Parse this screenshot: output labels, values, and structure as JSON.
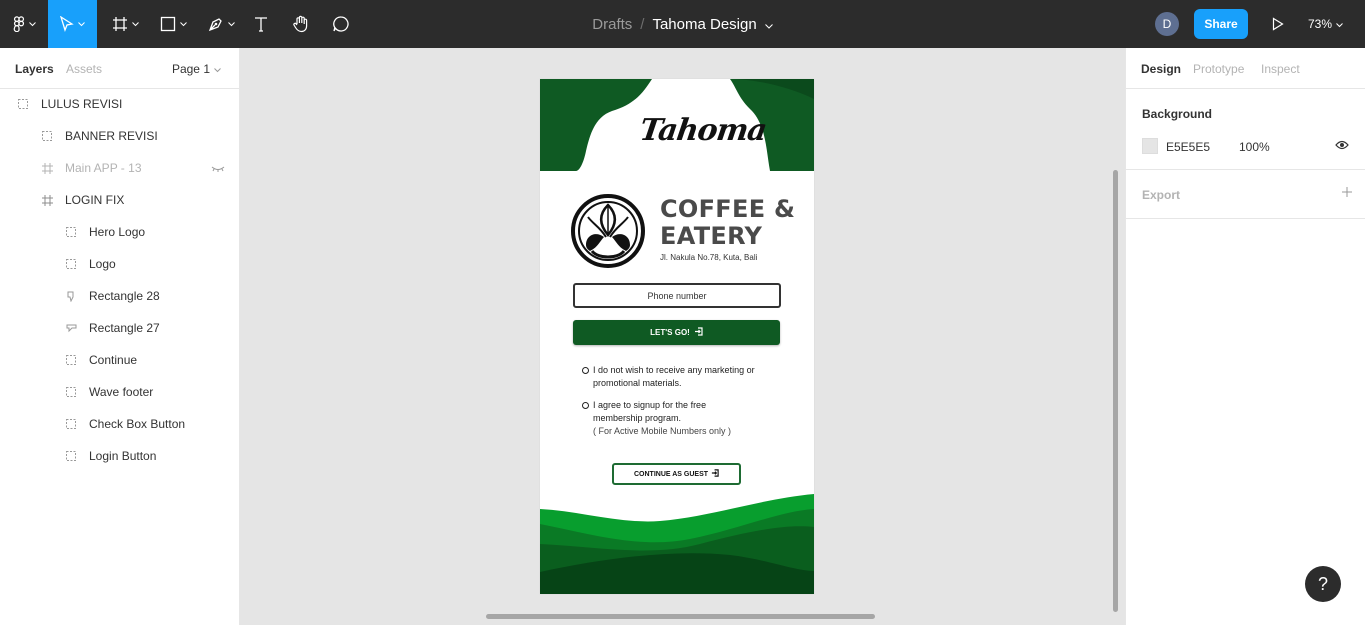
{
  "toolbar": {
    "breadcrumb": "Drafts",
    "separator": "/",
    "title": "Tahoma Design",
    "avatar_initial": "D",
    "share_label": "Share",
    "zoom": "73%",
    "accent": "#18a0fb"
  },
  "layers_panel": {
    "tab_layers": "Layers",
    "tab_assets": "Assets",
    "page": "Page 1",
    "items": [
      {
        "label": "LULUS REVISI",
        "icon": "group-icon"
      },
      {
        "label": "BANNER REVISI",
        "icon": "group-icon"
      },
      {
        "label": "Main APP - 13",
        "icon": "frame-icon"
      },
      {
        "label": "LOGIN FIX",
        "icon": "frame-icon"
      },
      {
        "label": "Hero Logo",
        "icon": "group-icon"
      },
      {
        "label": "Logo",
        "icon": "group-icon"
      },
      {
        "label": "Rectangle 28",
        "icon": "vector-icon"
      },
      {
        "label": "Rectangle 27",
        "icon": "vector-icon"
      },
      {
        "label": "Continue",
        "icon": "group-icon"
      },
      {
        "label": "Wave footer",
        "icon": "group-icon"
      },
      {
        "label": "Check Box Button",
        "icon": "group-icon"
      },
      {
        "label": "Login Button",
        "icon": "group-icon"
      }
    ]
  },
  "design_panel": {
    "tab_design": "Design",
    "tab_prototype": "Prototype",
    "tab_inspect": "Inspect",
    "background_heading": "Background",
    "background_hex": "E5E5E5",
    "background_opacity": "100%",
    "export_heading": "Export"
  },
  "frame": {
    "logo_text": "Tahoma",
    "title_line1": "COFFEE &",
    "title_line2": "EATERY",
    "address": "Jl. Nakula No.78, Kuta, Bali",
    "phone_placeholder": "Phone number",
    "go_label": "LET'S GO!",
    "check1_line1": "I do not wish to receive any marketing or",
    "check1_line2": "promotional materials.",
    "check2_line1": "I agree to signup for the free",
    "check2_line2": "membership program.",
    "check2_line3": "( For Active Mobile Numbers only )",
    "guest_label": "CONTINUE AS GUEST",
    "brand_green": "#0f5a23"
  },
  "help_label": "?"
}
